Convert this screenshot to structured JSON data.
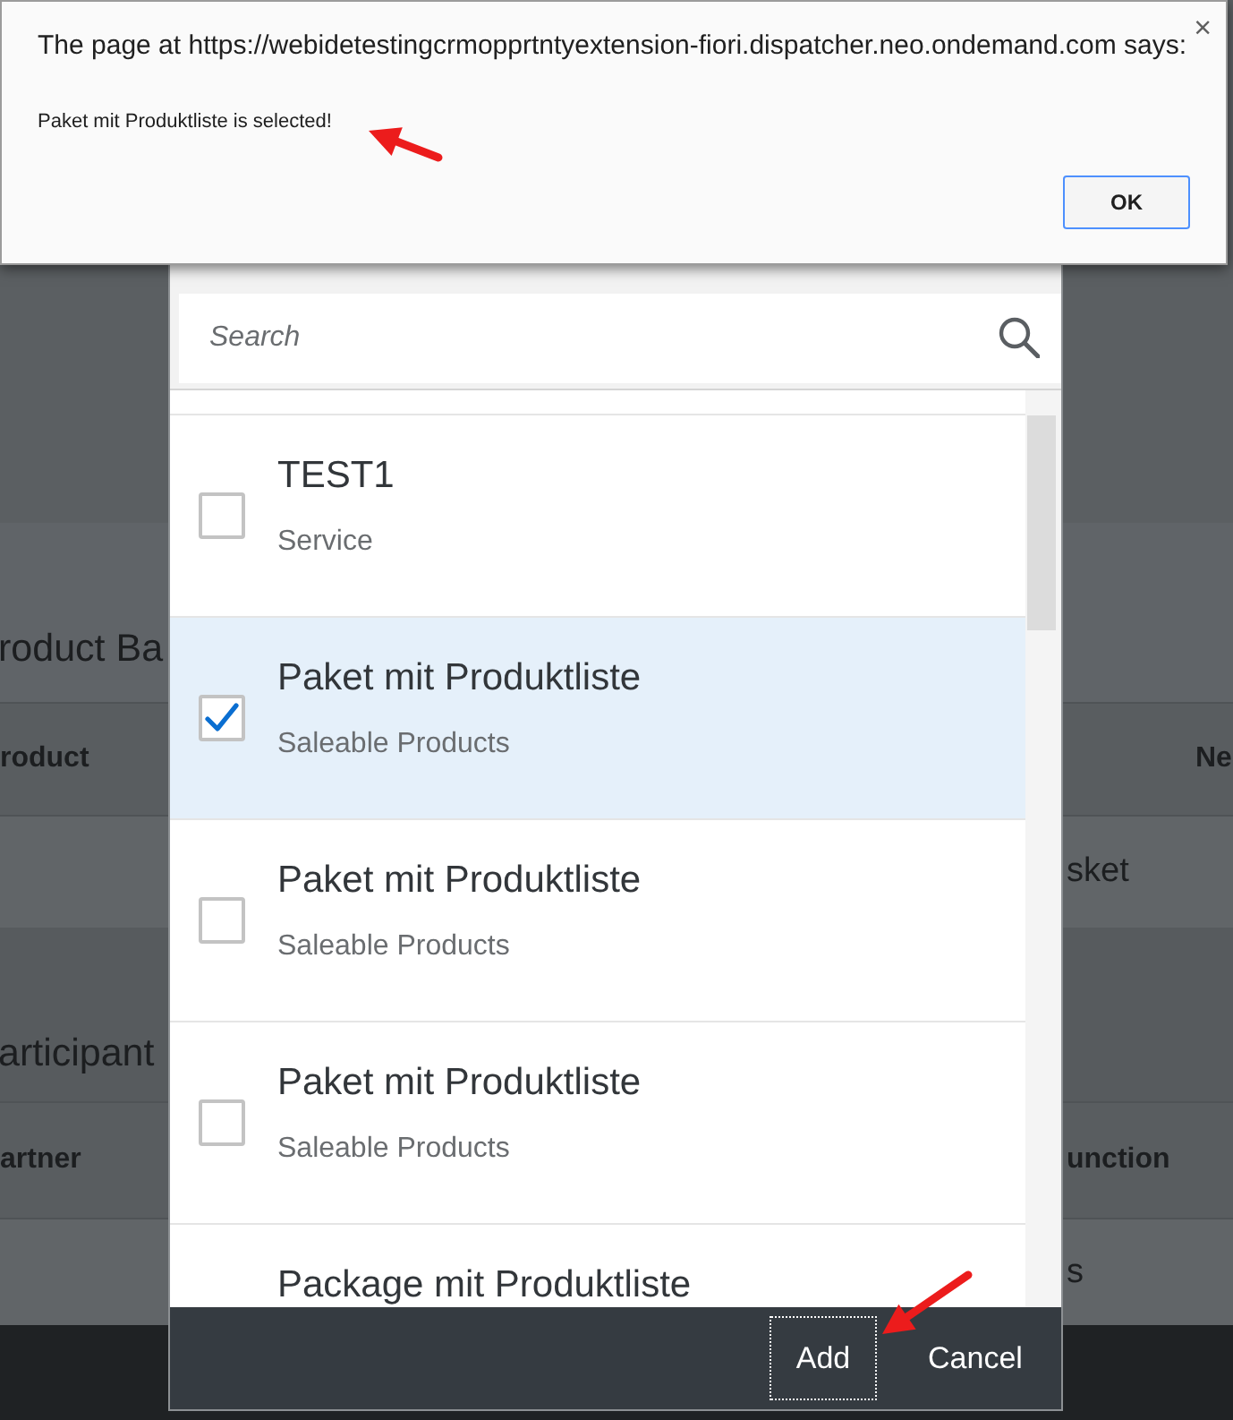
{
  "background_page": {
    "sections": [
      {
        "heading": "roduct Ba",
        "header": {
          "column_1": "roduct",
          "column_3": "Ne"
        },
        "row": {
          "column_2": "sket"
        }
      },
      {
        "heading": "articipant",
        "header": {
          "column_1": "artner",
          "column_2": "unction"
        },
        "row": {
          "column_2": "s"
        }
      }
    ]
  },
  "dialog": {
    "search": {
      "placeholder": "Search"
    },
    "items": [
      {
        "title": "TEST1",
        "subtitle": "Service",
        "selected": false,
        "checked": false
      },
      {
        "title": "Paket mit Produktliste",
        "subtitle": "Saleable Products",
        "selected": true,
        "checked": true
      },
      {
        "title": "Paket mit Produktliste",
        "subtitle": "Saleable Products",
        "selected": false,
        "checked": false
      },
      {
        "title": "Paket mit Produktliste",
        "subtitle": "Saleable Products",
        "selected": false,
        "checked": false
      },
      {
        "title": "Package mit Produktliste",
        "selected": false
      }
    ],
    "buttons": [
      {
        "label": "Add",
        "focused": true
      },
      {
        "label": "Cancel",
        "focused": false
      }
    ]
  },
  "alert": {
    "title": "The page at https://webidetestingcrmopprtntyextension-fiori.dispatcher.neo.ondemand.com says:",
    "close": "×",
    "message": "Paket mit Produktliste is selected!",
    "buttons": [
      "OK"
    ]
  }
}
